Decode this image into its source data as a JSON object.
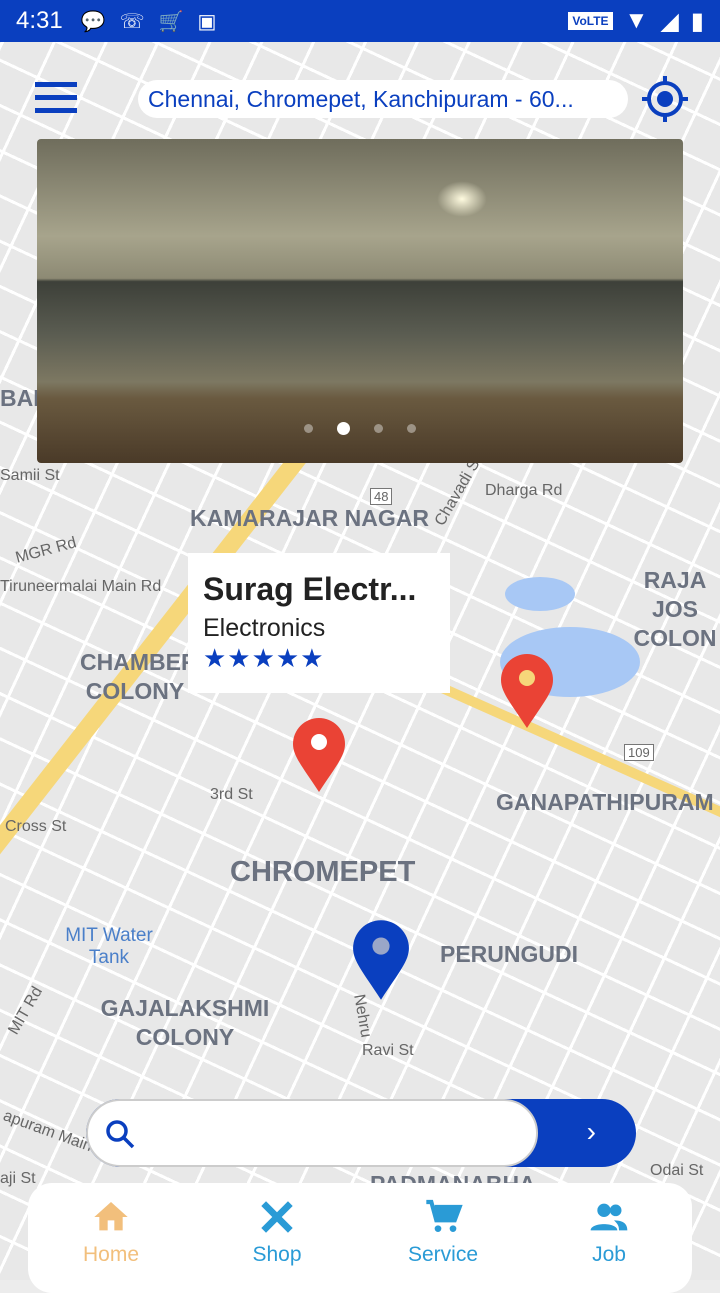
{
  "status_bar": {
    "time": "4:31",
    "volte": "VoLTE",
    "icons": [
      "message-icon",
      "missed-call-icon",
      "amazon-icon",
      "image-icon",
      "wifi-icon",
      "signal-icon",
      "battery-icon"
    ]
  },
  "header": {
    "address": "Chennai, Chromepet, Kanchipuram - 60...",
    "menu_icon": "hamburger-icon",
    "locate_icon": "gps-target-icon"
  },
  "banner": {
    "slide_count": 4,
    "active_slide": 2
  },
  "map": {
    "labels": [
      "KAMARAJAR NAGAR",
      "CHAMBERS COLONY",
      "CHROMEPET",
      "GANAPATHIPURAM",
      "PERUNGUDI",
      "GAJALAKSHMI COLONY",
      "RAJA JOS COLON",
      "BAD",
      "PADMANABHA"
    ],
    "streets": [
      "Dharga Rd",
      "Chavadi St",
      "MGR Rd",
      "Tiruneermalai Main Rd",
      "3rd St",
      "Cross St",
      "MIT Water Tank",
      "MIT Rd",
      "Ravi St",
      "Nehru",
      "Odai St",
      "Samii St",
      "48",
      "109",
      "apuram Main Rd",
      "aji St"
    ]
  },
  "info_card": {
    "name": "Surag Electr...",
    "category": "Electronics",
    "stars": "★★★★★",
    "rating": 5
  },
  "search": {
    "placeholder": "",
    "value": ""
  },
  "bottom_nav": {
    "items": [
      {
        "label": "Home",
        "icon": "home-icon",
        "active": true
      },
      {
        "label": "Shop",
        "icon": "tools-icon"
      },
      {
        "label": "Service",
        "icon": "cart-icon"
      },
      {
        "label": "Job",
        "icon": "people-icon"
      }
    ]
  },
  "colors": {
    "primary": "#0a3fbf",
    "pin_red": "#ea4335",
    "nav_active": "#f2bf7c",
    "nav_inactive": "#2a9bd6"
  }
}
